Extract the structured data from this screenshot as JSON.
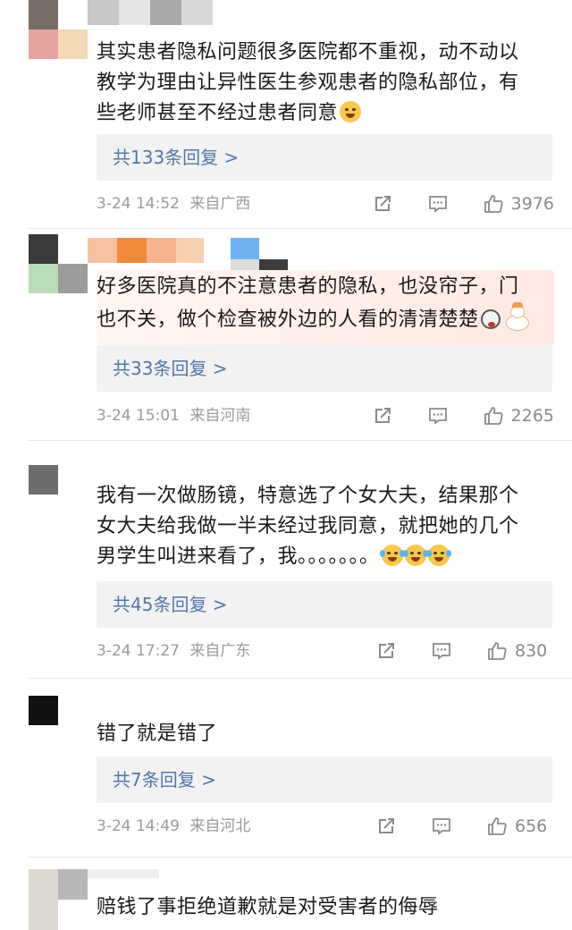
{
  "comments": [
    {
      "text_lines": [
        "其实患者隐私问题很多医院都不重视，动不动以",
        "教学为理由让异性医生参观患者的隐私部位，有",
        "些老师甚至不经过患者同意"
      ],
      "emoji": "tired-emoji",
      "replies_label": "共133条回复 >",
      "date": "3-24 14:52",
      "location": "来自广西",
      "likes": "3976"
    },
    {
      "text_lines": [
        "好多医院真的不注意患者的隐私，也没帘子，门",
        "也不关，做个检查被外边的人看的清清楚楚"
      ],
      "emoji": "dog-emoji",
      "replies_label": "共33条回复 >",
      "date": "3-24 15:01",
      "location": "来自河南",
      "likes": "2265"
    },
    {
      "text_lines": [
        "我有一次做肠镜，特意选了个女大夫，结果那个",
        "女大夫给我做一半未经过我同意，就把她的几个",
        "男学生叫进来看了，我。。。。。。。"
      ],
      "emoji": "laugh-cry-emoji",
      "replies_label": "共45条回复 >",
      "date": "3-24 17:27",
      "location": "来自广东",
      "likes": "830"
    },
    {
      "text_lines": [
        "错了就是错了"
      ],
      "replies_label": "共7条回复 >",
      "date": "3-24 14:49",
      "location": "来自河北",
      "likes": "656"
    },
    {
      "text_lines": [
        "赔钱了事拒绝道歉就是对受害者的侮辱"
      ]
    }
  ],
  "colors": {
    "reply_link": "#5277a8",
    "meta_text": "#9b9b9b",
    "reply_bg": "#f2f2f2"
  },
  "icons": [
    "share-icon",
    "comment-icon",
    "like-icon"
  ]
}
